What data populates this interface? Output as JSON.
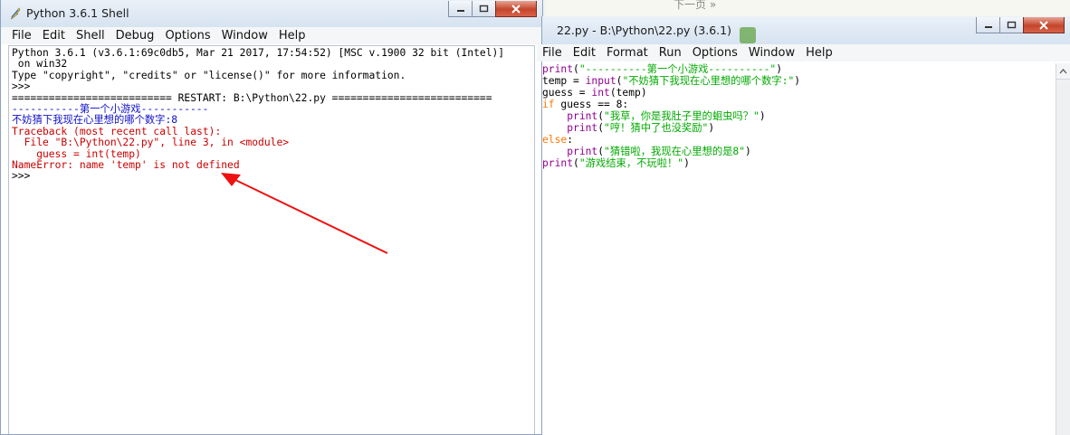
{
  "background": {
    "next_link": "下一页 »"
  },
  "shell": {
    "title": "Python 3.6.1 Shell",
    "icon": "python-feather-icon",
    "menu": [
      "File",
      "Edit",
      "Shell",
      "Debug",
      "Options",
      "Window",
      "Help"
    ],
    "lines": [
      {
        "text": "Python 3.6.1 (v3.6.1:69c0db5, Mar 21 2017, 17:54:52) [MSC v.1900 32 bit (Intel)]",
        "color": "black"
      },
      {
        "text": " on win32",
        "color": "black"
      },
      {
        "text": "Type \"copyright\", \"credits\" or \"license()\" for more information.",
        "color": "black"
      },
      {
        "text": ">>> ",
        "color": "black"
      },
      {
        "text": "========================== RESTART: B:\\Python\\22.py ==========================",
        "color": "black"
      },
      {
        "text": "-----------第一个小游戏-----------",
        "color": "blue"
      },
      {
        "text": "不妨猜下我现在心里想的哪个数字:8",
        "color": "blue"
      },
      {
        "text": "Traceback (most recent call last):",
        "color": "red"
      },
      {
        "text": "  File \"B:\\Python\\22.py\", line 3, in <module>",
        "color": "red"
      },
      {
        "text": "    guess = int(temp)",
        "color": "red"
      },
      {
        "text": "NameError: name 'temp' is not defined",
        "color": "red"
      },
      {
        "text": ">>> ",
        "color": "black"
      }
    ]
  },
  "editor": {
    "title": "22.py - B:\\Python\\22.py (3.6.1)",
    "menu": [
      "File",
      "Edit",
      "Format",
      "Run",
      "Options",
      "Window",
      "Help"
    ],
    "lines": [
      [
        {
          "t": "print",
          "c": "bi"
        },
        {
          "t": "(",
          "c": "n"
        },
        {
          "t": "\"----------第一个小游戏----------\"",
          "c": "st"
        },
        {
          "t": ")",
          "c": "n"
        }
      ],
      [
        {
          "t": "temp = ",
          "c": "n"
        },
        {
          "t": "input",
          "c": "bi"
        },
        {
          "t": "(",
          "c": "n"
        },
        {
          "t": "\"不妨猜下我现在心里想的哪个数字:\"",
          "c": "st"
        },
        {
          "t": ")",
          "c": "n"
        }
      ],
      [
        {
          "t": "guess = ",
          "c": "n"
        },
        {
          "t": "int",
          "c": "bi"
        },
        {
          "t": "(temp)",
          "c": "n"
        }
      ],
      [
        {
          "t": "if",
          "c": "kw"
        },
        {
          "t": " guess == 8:",
          "c": "n"
        }
      ],
      [
        {
          "t": "    ",
          "c": "n"
        },
        {
          "t": "print",
          "c": "bi"
        },
        {
          "t": "(",
          "c": "n"
        },
        {
          "t": "\"我草，你是我肚子里的蛔虫吗？\"",
          "c": "st"
        },
        {
          "t": ")",
          "c": "n"
        }
      ],
      [
        {
          "t": "    ",
          "c": "n"
        },
        {
          "t": "print",
          "c": "bi"
        },
        {
          "t": "(",
          "c": "n"
        },
        {
          "t": "\"哼！猜中了也没奖励\"",
          "c": "st"
        },
        {
          "t": ")",
          "c": "n"
        }
      ],
      [
        {
          "t": "else",
          "c": "kw"
        },
        {
          "t": ":",
          "c": "n"
        }
      ],
      [
        {
          "t": "    ",
          "c": "n"
        },
        {
          "t": "print",
          "c": "bi"
        },
        {
          "t": "(",
          "c": "n"
        },
        {
          "t": "\"猜错啦，我现在心里想的是8\"",
          "c": "st"
        },
        {
          "t": ")",
          "c": "n"
        }
      ],
      [
        {
          "t": "print",
          "c": "bi"
        },
        {
          "t": "(",
          "c": "n"
        },
        {
          "t": "\"游戏结束，不玩啦！\"",
          "c": "st"
        },
        {
          "t": ")",
          "c": "n"
        }
      ]
    ]
  },
  "colors": {
    "shell_output_blue": "#1010c8",
    "error_red": "#cc0000",
    "keyword_orange": "#ff7700",
    "builtin_purple": "#900090",
    "string_green": "#00aa00",
    "annotation_arrow": "#ee1111"
  }
}
